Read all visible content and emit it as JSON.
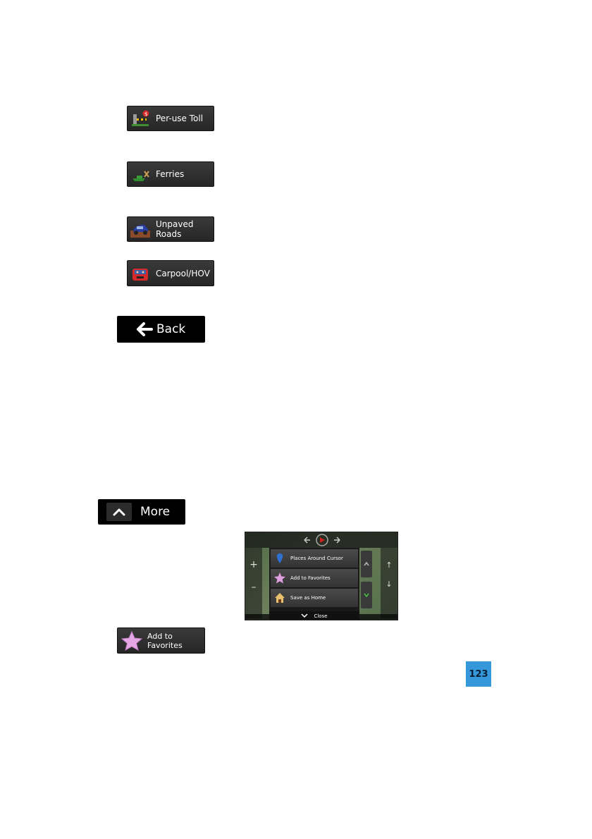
{
  "buttons": {
    "per_use_toll": "Per-use Toll",
    "ferries": "Ferries",
    "unpaved_roads": "Unpaved Roads",
    "carpool_hov": "Carpool/HOV",
    "back": "Back",
    "more": "More",
    "add_to_favorites": "Add to Favorites"
  },
  "screenshot": {
    "menu_items": [
      "Places Around Cursor",
      "Add to Favorites",
      "Save as Home"
    ],
    "close_label": "Close"
  },
  "page_number": "123",
  "colors": {
    "page_badge": "#3498db",
    "button_bg": "#2e2e2e",
    "star": "#e0a0e0"
  }
}
